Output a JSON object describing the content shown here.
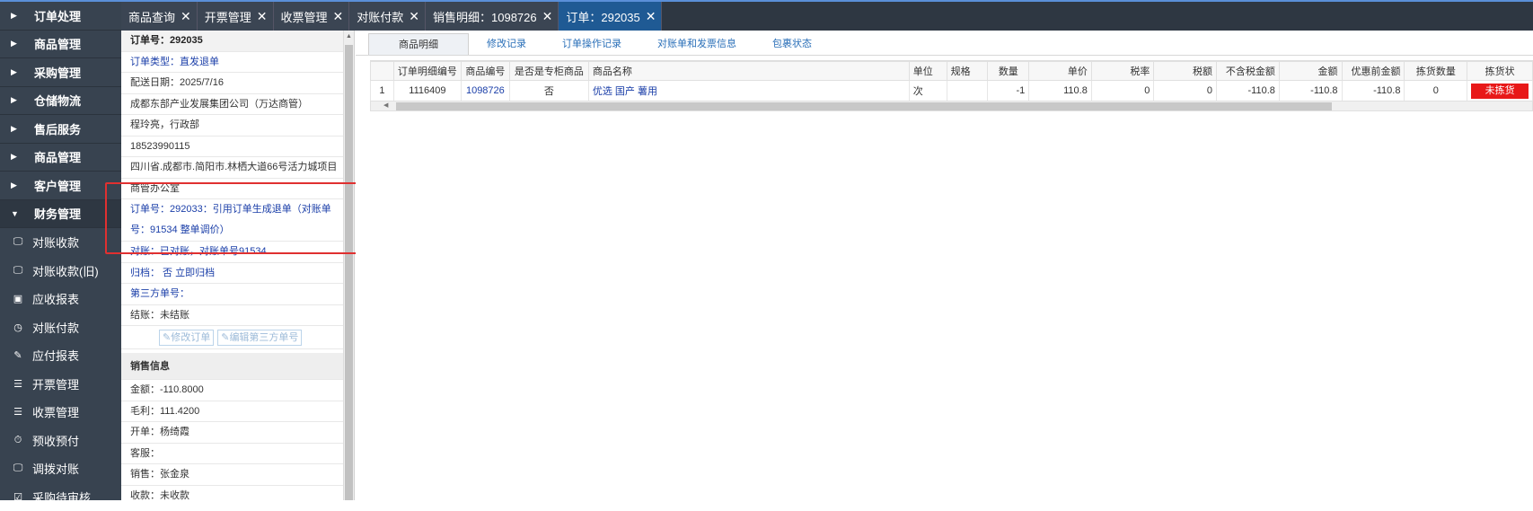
{
  "sidebar": {
    "menus": [
      {
        "label": "订单处理",
        "open": false
      },
      {
        "label": "商品管理",
        "open": false
      },
      {
        "label": "采购管理",
        "open": false
      },
      {
        "label": "仓储物流",
        "open": false
      },
      {
        "label": "售后服务",
        "open": false
      },
      {
        "label": "商品管理",
        "open": false
      },
      {
        "label": "客户管理",
        "open": false
      },
      {
        "label": "财务管理",
        "open": true
      }
    ],
    "finance_items": [
      {
        "label": "对账收款",
        "icon": "monitor-icon"
      },
      {
        "label": "对账收款(旧)",
        "icon": "monitor-icon"
      },
      {
        "label": "应收报表",
        "icon": "calendar-icon"
      },
      {
        "label": "对账付款",
        "icon": "clock-icon"
      },
      {
        "label": "应付报表",
        "icon": "edit-icon"
      },
      {
        "label": "开票管理",
        "icon": "document-icon"
      },
      {
        "label": "收票管理",
        "icon": "document-icon"
      },
      {
        "label": "预收预付",
        "icon": "timer-icon"
      },
      {
        "label": "调拨对账",
        "icon": "monitor-icon"
      },
      {
        "label": "采购待审核",
        "icon": "checkbox-icon"
      }
    ]
  },
  "tabs": [
    {
      "label": "商品查询",
      "active": false
    },
    {
      "label": "开票管理",
      "active": false
    },
    {
      "label": "收票管理",
      "active": false
    },
    {
      "label": "对账付款",
      "active": false
    },
    {
      "label": "销售明细：1098726",
      "active": false
    },
    {
      "label": "订单：292035",
      "active": true
    }
  ],
  "close_glyph": "✕",
  "order_info": {
    "header": "订单号：292035",
    "order_type": "订单类型：直发退单",
    "delivery_date": "配送日期：2025/7/16",
    "company": "成都东部产业发展集团公司（万达商管）",
    "contact": "程玲亮，行政部",
    "phone": "18523990115",
    "address": "四川省.成都市.简阳市.林栖大道66号活力城项目",
    "office": "商管办公室",
    "ref_order": "订单号：292033：引用订单生成退单（对账单号：91534 整单调价）",
    "reconcile": "对账：已对账，对账单号91534",
    "archive": "归档： 否 立即归档",
    "third_party": "第三方单号：",
    "settle": "结账：未结账",
    "edit_order_btn": "修改订单",
    "edit_third_btn": "编辑第三方单号"
  },
  "sales_info": {
    "header": "销售信息",
    "amount": "金额：-110.8000",
    "gross_profit": "毛利：111.4200",
    "issuer": "开单：杨绮霞",
    "customer_service": "客服：",
    "sales": "销售：张金泉",
    "receipt": "收款：未收款"
  },
  "subtabs": [
    {
      "label": "商品明细",
      "active": true
    },
    {
      "label": "修改记录",
      "active": false
    },
    {
      "label": "订单操作记录",
      "active": false
    },
    {
      "label": "对账单和发票信息",
      "active": false
    },
    {
      "label": "包裹状态",
      "active": false
    }
  ],
  "grid": {
    "columns": [
      "",
      "订单明细编号",
      "商品编号",
      "是否是专柜商品",
      "商品名称",
      "单位",
      "规格",
      "数量",
      "单价",
      "税率",
      "税额",
      "不含税金额",
      "金额",
      "优惠前金额",
      "拣货数量",
      "拣货状"
    ],
    "rows": [
      {
        "index": "1",
        "detail_id": "1116409",
        "product_id": "1098726",
        "is_counter": "否",
        "name": "优选 国产 薯用",
        "unit": "次",
        "spec": "",
        "qty": "-1",
        "price": "110.8",
        "tax_rate": "0",
        "tax": "0",
        "net_amount": "-110.8",
        "amount": "-110.8",
        "pre_discount": "-110.8",
        "picked_qty": "0",
        "pick_status": "未拣货"
      }
    ],
    "status_color": "#e81818"
  },
  "accent_color": "#1f5a94",
  "annotation_color": "#e03030"
}
